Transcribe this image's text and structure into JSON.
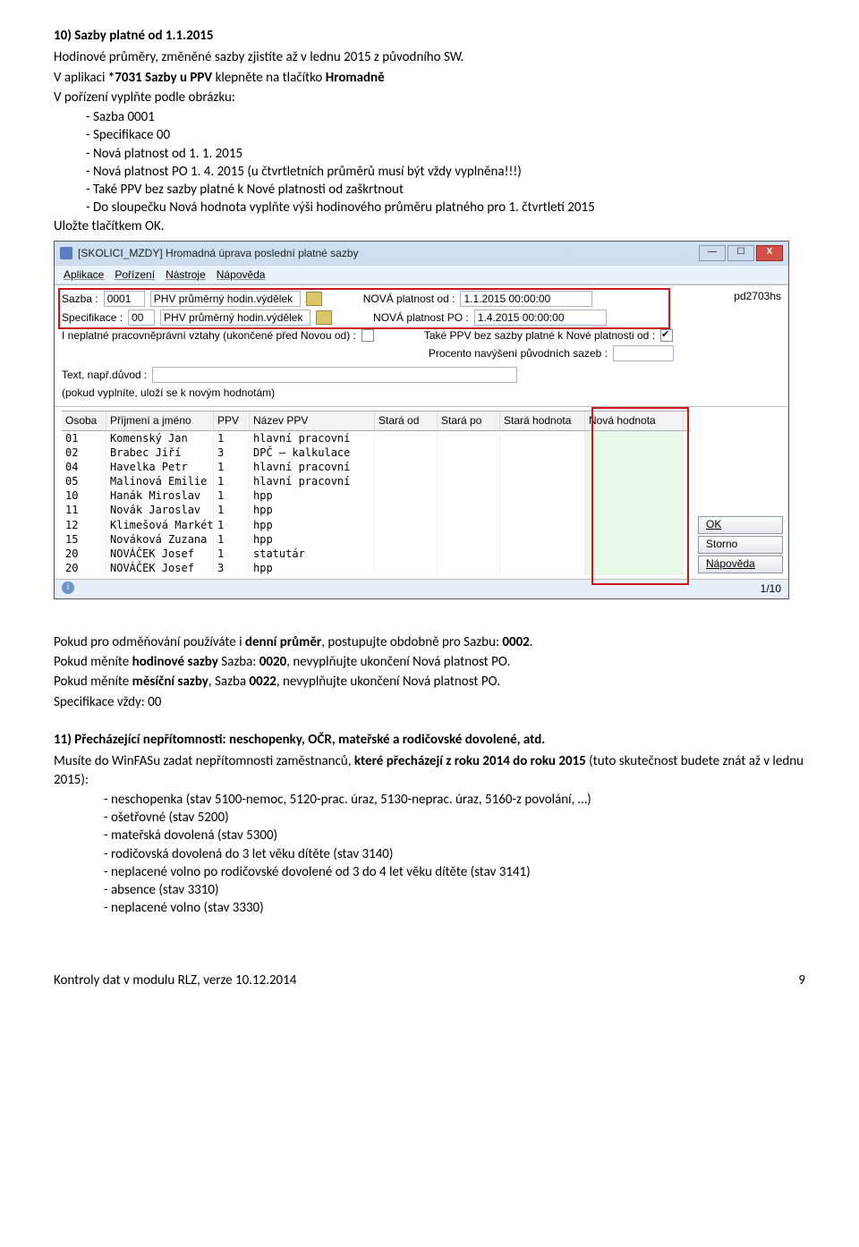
{
  "section10": {
    "title": "10) Sazby platné od 1.1.2015",
    "line1": "Hodinové průměry, změněné sazby zjistíte až v lednu 2015 z původního SW.",
    "line2a": "V aplikaci ",
    "line2b": "*7031 Sazby u PPV",
    "line2c": " klepněte na tlačítko ",
    "line2d": "Hromadně",
    "line3": "V pořízení vyplňte podle obrázku:",
    "items": [
      "Sazba 0001",
      "Specifikace 00",
      "Nová platnost od 1. 1. 2015",
      "Nová platnost PO 1. 4. 2015 (u čtvrtletních průměrů musí být vždy vyplněna!!!)",
      "Také PPV bez sazby platné k Nové platnosti od zaškrtnout",
      "Do sloupečku Nová hodnota vyplňte výši hodinového průměru platného pro 1. čtvrtletí 2015"
    ],
    "save": "Uložte tlačítkem OK."
  },
  "win": {
    "title": "[SKOLICI_MZDY] Hromadná úprava poslední platné sazby",
    "btn_min": "—",
    "btn_max": "☐",
    "btn_close": "X",
    "menu": [
      "Aplikace",
      "Pořízení",
      "Nástroje",
      "Nápověda"
    ],
    "pd": "pd2703hs",
    "lbl_sazba": "Sazba :",
    "v_sazba": "0001",
    "v_sazbad": "PHV průměrný hodin.výdělek",
    "lbl_nova_od": "NOVÁ platnost od :",
    "v_nova_od": "1.1.2015 00:00:00",
    "lbl_spec": "Specifikace :",
    "v_spec": "00",
    "v_specd": "PHV průměrný hodin.výdělek",
    "lbl_nova_po": "NOVÁ platnost PO :",
    "v_nova_po": "1.4.2015 00:00:00",
    "lbl_ineplat": "I neplatné pracovněprávní vztahy (ukončené před Novou od) :",
    "lbl_takeppv": "Také PPV bez sazby platné k Nové platnosti od :",
    "lbl_procento": "Procento navýšení původních sazeb :",
    "lbl_text": "Text, např.důvod :",
    "lbl_pokud": "(pokud vyplníte, uloží se k novým hodnotám)",
    "cols": [
      "Osoba",
      "Příjmení a jméno",
      "PPV",
      "Název PPV",
      "Stará od",
      "Stará po",
      "Stará hodnota",
      "Nová hodnota"
    ],
    "rows": [
      [
        "01",
        "Komenský Jan",
        "1",
        "hlavní pracovní",
        "",
        "",
        "",
        ""
      ],
      [
        "02",
        "Brabec Jiří",
        "3",
        "DPČ – kalkulace",
        "",
        "",
        "",
        ""
      ],
      [
        "04",
        "Havelka Petr",
        "1",
        "hlavní pracovní",
        "",
        "",
        "",
        ""
      ],
      [
        "05",
        "Malinová Emilie",
        "1",
        "hlavní pracovní",
        "",
        "",
        "",
        ""
      ],
      [
        "10",
        "Hanák Miroslav",
        "1",
        "hpp",
        "",
        "",
        "",
        ""
      ],
      [
        "11",
        "Novák Jaroslav",
        "1",
        "hpp",
        "",
        "",
        "",
        ""
      ],
      [
        "12",
        "Klimešová Markét",
        "1",
        "hpp",
        "",
        "",
        "",
        ""
      ],
      [
        "15",
        "Nováková  Zuzana",
        "1",
        "hpp",
        "",
        "",
        "",
        ""
      ],
      [
        "20",
        "NOVÁČEK Josef",
        "1",
        "statutár",
        "",
        "",
        "",
        ""
      ],
      [
        "20",
        "NOVÁČEK Josef",
        "3",
        "hpp",
        "",
        "",
        "",
        ""
      ]
    ],
    "btn_ok": "OK",
    "btn_storno": "Storno",
    "btn_nap": "Nápověda",
    "status_i": "i",
    "status_page": "1/10"
  },
  "after": {
    "p1a": "Pokud pro odměňování používáte i ",
    "p1b": "denní průměr",
    "p1c": ", postupujte obdobně pro Sazbu: ",
    "p1d": "0002",
    "p1e": ".",
    "p2a": "Pokud měníte ",
    "p2b": "hodinové sazby",
    "p2c": " Sazba: ",
    "p2d": "0020",
    "p2e": ", nevyplňujte ukončení Nová platnost PO.",
    "p3a": "Pokud měníte ",
    "p3b": "měsíční sazby",
    "p3c": ", Sazba ",
    "p3d": "0022",
    "p3e": ", nevyplňujte ukončení Nová platnost PO.",
    "p4": "Specifikace vždy: 00"
  },
  "section11": {
    "title": "11) Přecházející nepřítomnosti: neschopenky, OČR, mateřské a rodičovské dovolené, atd.",
    "l1a": "Musíte do WinFASu zadat nepřítomnosti zaměstnanců, ",
    "l1b": "které přecházejí z roku 2014 do roku 2015",
    "l1c": " (tuto skutečnost budete znát až v lednu 2015):",
    "items": [
      "neschopenka (stav 5100-nemoc, 5120-prac. úraz, 5130-neprac. úraz, 5160-z povolání, …)",
      "ošetřovné (stav 5200)",
      "mateřská dovolená (stav 5300)",
      "rodičovská dovolená do 3 let věku dítěte (stav 3140)",
      "neplacené volno po rodičovské dovolené od 3 do 4 let věku dítěte (stav 3141)",
      "absence (stav 3310)",
      "neplacené volno (stav 3330)"
    ]
  },
  "footer": {
    "left": "Kontroly dat v modulu RLZ, verze 10.12.2014",
    "page": "9"
  }
}
